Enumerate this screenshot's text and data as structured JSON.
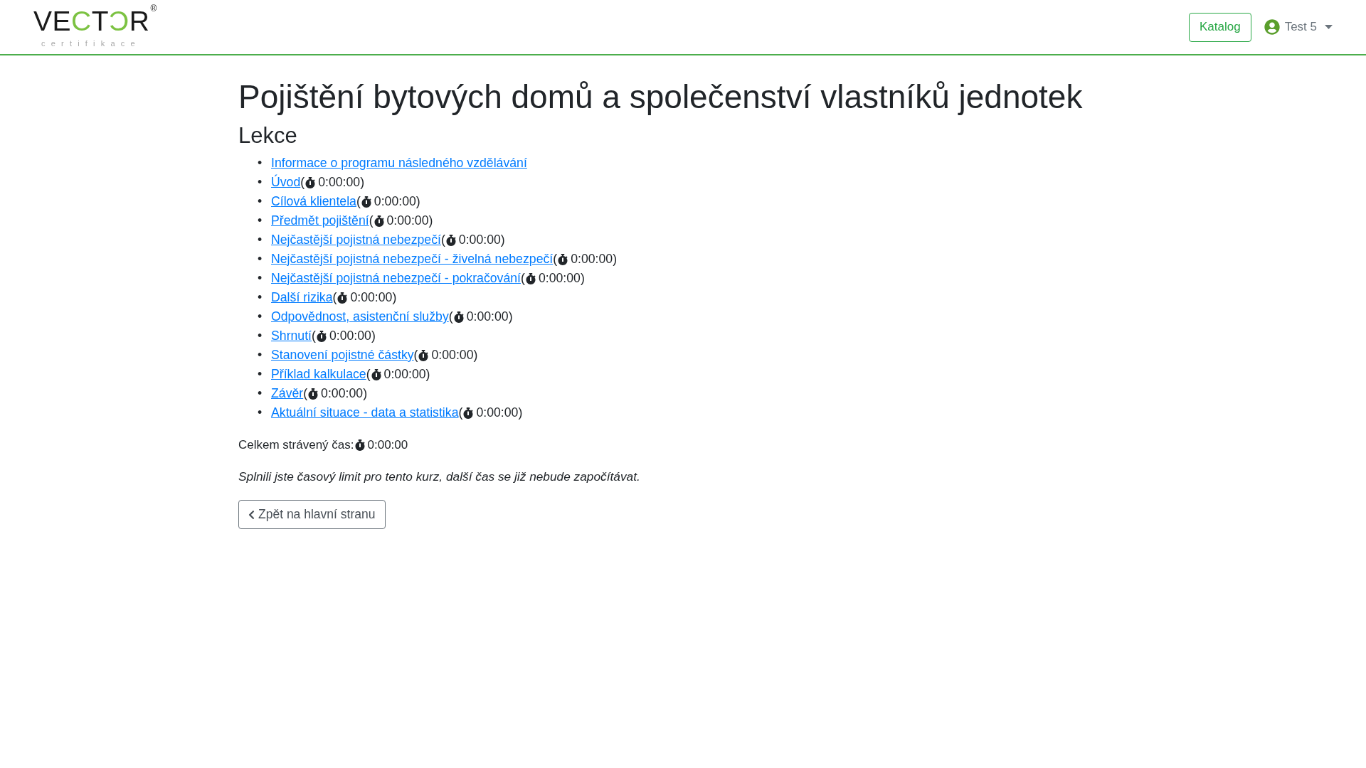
{
  "header": {
    "logo": {
      "wordmark": [
        {
          "text": "VE",
          "accent": false
        },
        {
          "text": "C",
          "accent": true
        },
        {
          "text": "T",
          "accent": false
        },
        {
          "text": "Ɔ",
          "accent": true
        },
        {
          "text": "R",
          "accent": false
        }
      ],
      "registered": "®",
      "tagline": "certifikace"
    },
    "catalog_button": "Katalog",
    "user_menu": {
      "name": "Test 5"
    }
  },
  "page": {
    "title": "Pojištění bytových domů a společenství vlastníků jednotek",
    "section_title": "Lekce",
    "lessons": [
      {
        "bullet": "•",
        "title": "Informace o programu následného vzdělávání"
      },
      {
        "bullet": "•",
        "title": "Úvod",
        "duration": {
          "open": "(",
          "time": "0:00:00",
          "close": ")"
        }
      },
      {
        "bullet": "•",
        "title": "Cílová klientela",
        "duration": {
          "open": "(",
          "time": "0:00:00",
          "close": ")"
        }
      },
      {
        "bullet": "•",
        "title": "Předmět pojištění",
        "duration": {
          "open": "(",
          "time": "0:00:00",
          "close": ")"
        }
      },
      {
        "bullet": "•",
        "title": "Nejčastější pojistná nebezpečí",
        "duration": {
          "open": "(",
          "time": "0:00:00",
          "close": ")"
        }
      },
      {
        "bullet": "•",
        "title": "Nejčastější pojistná nebezpečí - živelná nebezpečí",
        "duration": {
          "open": "(",
          "time": "0:00:00",
          "close": ")"
        }
      },
      {
        "bullet": "•",
        "title": "Nejčastější pojistná nebezpečí - pokračování",
        "duration": {
          "open": "(",
          "time": "0:00:00",
          "close": ")"
        }
      },
      {
        "bullet": "•",
        "title": "Další rizika",
        "duration": {
          "open": "(",
          "time": "0:00:00",
          "close": ")"
        }
      },
      {
        "bullet": "•",
        "title": "Odpovědnost, asistenční služby",
        "duration": {
          "open": "(",
          "time": "0:00:00",
          "close": ")"
        }
      },
      {
        "bullet": "•",
        "title": "Shrnutí",
        "duration": {
          "open": "(",
          "time": "0:00:00",
          "close": ")"
        }
      },
      {
        "bullet": "•",
        "title": "Stanovení pojistné částky",
        "duration": {
          "open": "(",
          "time": "0:00:00",
          "close": ")"
        }
      },
      {
        "bullet": "•",
        "title": "Příklad kalkulace",
        "duration": {
          "open": "(",
          "time": "0:00:00",
          "close": ")"
        }
      },
      {
        "bullet": "•",
        "title": "Závěr",
        "duration": {
          "open": "(",
          "time": "0:00:00",
          "close": ")"
        }
      },
      {
        "bullet": "•",
        "title": "Aktuální situace - data a statistika",
        "duration": {
          "open": "(",
          "time": "0:00:00",
          "close": ")"
        }
      }
    ],
    "total": {
      "label": "Celkem strávený čas:",
      "time": "0:00:00"
    },
    "note": "Splnili jste časový limit pro tento kurz, další čas se již nebude započítávat.",
    "back_button": "Zpět na hlavní stranu"
  }
}
